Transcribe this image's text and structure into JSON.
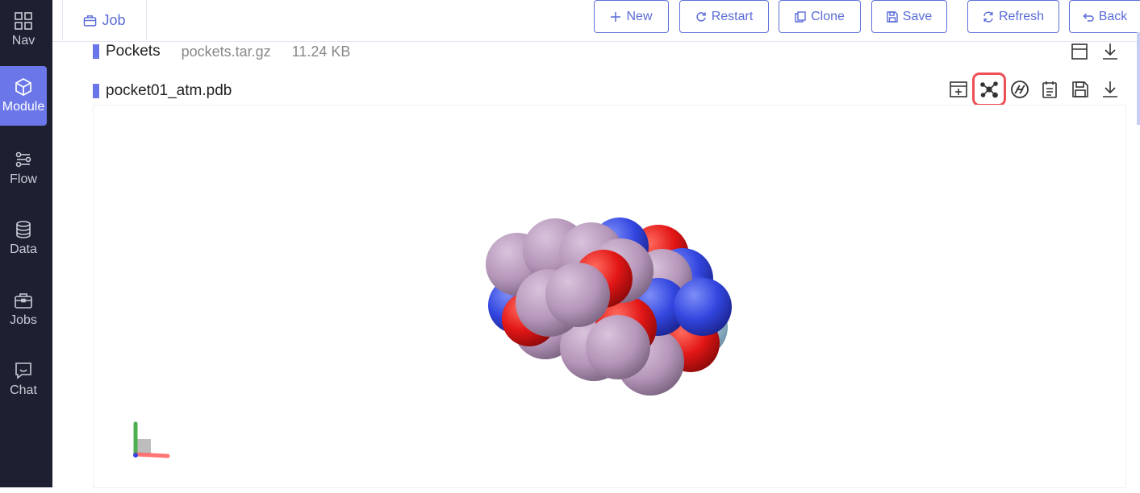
{
  "sidebar": {
    "items": [
      {
        "label": "Nav",
        "icon": "grid-icon"
      },
      {
        "label": "Module",
        "icon": "cube-icon",
        "active": true
      },
      {
        "label": "Flow",
        "icon": "flow-icon"
      },
      {
        "label": "Data",
        "icon": "database-icon"
      },
      {
        "label": "Jobs",
        "icon": "briefcase-icon"
      },
      {
        "label": "Chat",
        "icon": "chat-icon"
      }
    ]
  },
  "header": {
    "tab_label": "Job",
    "buttons": {
      "new": "New",
      "restart": "Restart",
      "clone": "Clone",
      "save": "Save",
      "refresh": "Refresh",
      "back": "Back"
    }
  },
  "files": [
    {
      "name": "Pockets",
      "filename": "pockets.tar.gz",
      "size": "11.24 KB"
    },
    {
      "name": "pocket01_atm.pdb"
    }
  ],
  "toolbar": {
    "icons": [
      "add-panel-icon",
      "molecule-network-icon",
      "dna-icon",
      "notes-icon",
      "save-icon",
      "download-icon"
    ],
    "highlighted": "molecule-network-icon"
  },
  "colors": {
    "accent": "#6b77e8",
    "sidebar_bg": "#1c2030",
    "carbon": "#b596b9",
    "oxygen": "#e21616",
    "nitrogen": "#3347e0",
    "hydrogen": "#a8c8dc",
    "highlight": "#ee4e55"
  }
}
